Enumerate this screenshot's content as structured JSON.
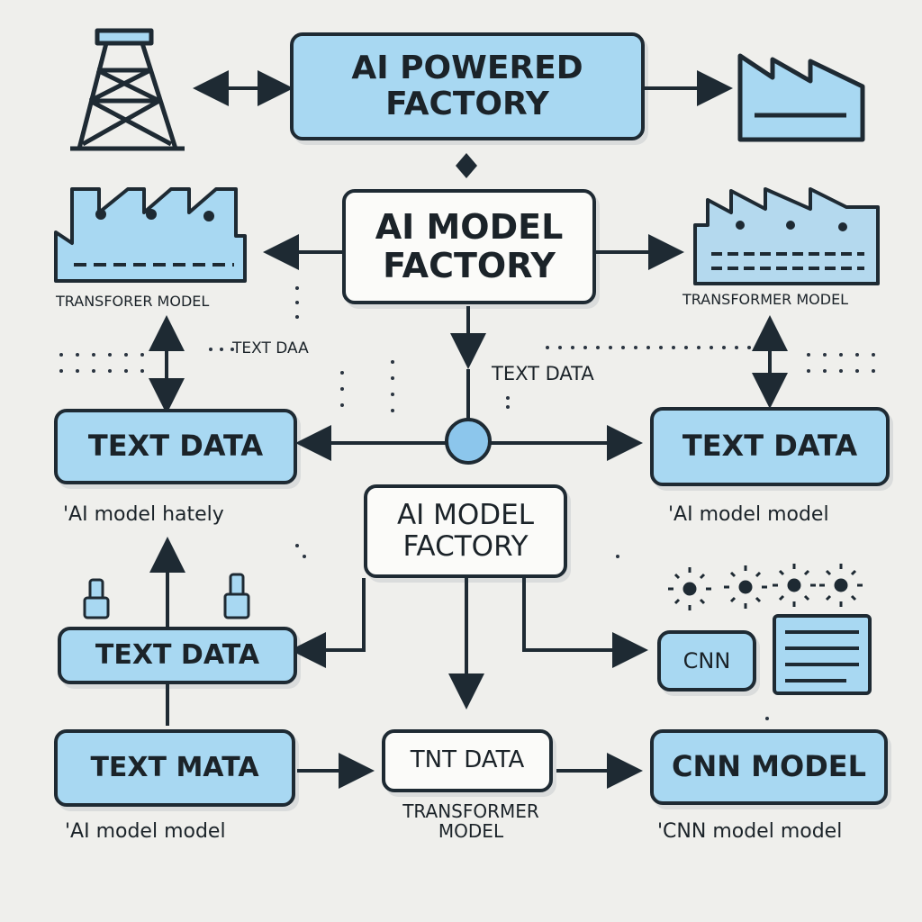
{
  "boxes": {
    "ai_powered_factory": "AI  POWERED\nFACTORY",
    "ai_model_factory_top": "AI MODEL\nFACTORY",
    "ai_model_factory_mid": "AI MODEL\nFACTORY",
    "text_data_left": "TEXT DATA",
    "text_data_right": "TEXT DATA",
    "text_data_lower": "TEXT DATA",
    "text_mata": "TEXT MATA",
    "tnt_data": "TNT DATA",
    "cnn_small": "CNN",
    "cnn_model": "CNN MODEL"
  },
  "labels": {
    "transformer_model_left": "TRANSFORER MODEL",
    "transformer_model_right": "TRANSFORMER MODEL",
    "text_daa": "TEXT DAA",
    "text_data_center": "TEXT DATA",
    "ai_model_hately": "'AI model hately",
    "ai_model_model_right": "'AI model model",
    "ai_model_model_left": "'AI model model",
    "transformer_model_bottom": "TRANSFORMER\nMODEL",
    "cnn_model_model": "'CNN model model"
  },
  "icons": [
    "oil-derrick-icon",
    "factory-icon",
    "factory-left-icon",
    "factory-right-icon",
    "hub-node-icon",
    "sensor-left-icon",
    "sensor-right-icon",
    "gear-icon",
    "document-icon"
  ],
  "colors": {
    "box_blue": "#a8d8f2",
    "box_white": "#fbfbf9",
    "stroke": "#1e2a33",
    "background": "#efefec"
  }
}
